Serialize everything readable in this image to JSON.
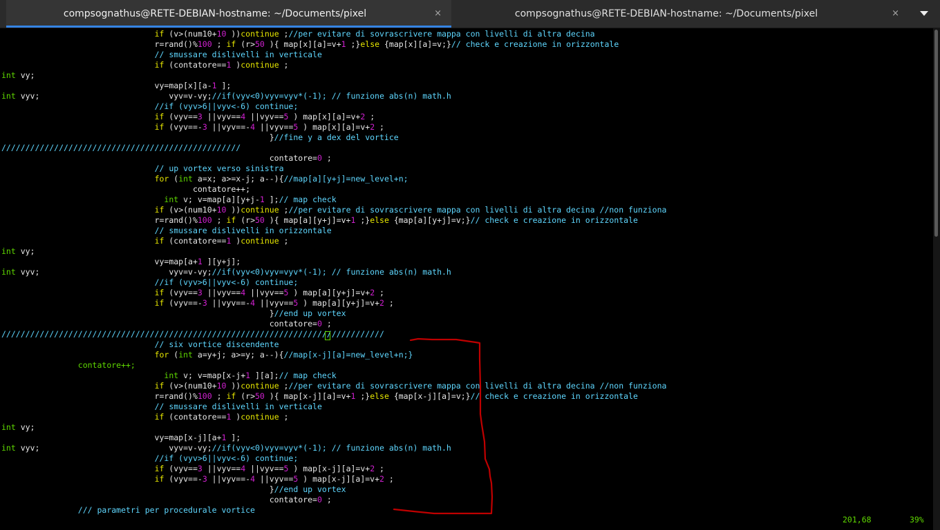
{
  "tabs": [
    {
      "title": "compsognathus@RETE-DEBIAN-hostname: ~/Documents/pixel",
      "active": true
    },
    {
      "title": "compsognathus@RETE-DEBIAN-hostname: ~/Documents/pixel",
      "active": false
    }
  ],
  "close_glyph": "×",
  "status": {
    "position": "201,68",
    "percent": "39%"
  },
  "annotation_color": "#c00000",
  "code_lines": [
    [
      [
        "",
        "                                "
      ],
      [
        "kw",
        "if"
      ],
      [
        "",
        " (v>(num10+"
      ],
      [
        "nm",
        "10"
      ],
      [
        "",
        " ))"
      ],
      [
        "kw",
        "continue"
      ],
      [
        "",
        " ;"
      ],
      [
        "cm",
        "//per evitare di sovrascrivere mappa con livelli di altra decina"
      ]
    ],
    [
      [
        "",
        "                                r=rand()%"
      ],
      [
        "nm",
        "100"
      ],
      [
        "",
        " ; "
      ],
      [
        "kw",
        "if"
      ],
      [
        "",
        " (r>"
      ],
      [
        "nm",
        "50"
      ],
      [
        "",
        " ){ map[x][a]=v+"
      ],
      [
        "nm",
        "1"
      ],
      [
        "",
        " ;}"
      ],
      [
        "kw",
        "else"
      ],
      [
        "",
        " {map[x][a]=v;}"
      ],
      [
        "cm",
        "// check e creazione in orizzontale"
      ]
    ],
    [
      [
        "",
        "                                "
      ],
      [
        "cm",
        "// smussare dislivelli in verticale"
      ]
    ],
    [
      [
        "",
        "                                "
      ],
      [
        "kw",
        "if"
      ],
      [
        "",
        " (contatore=="
      ],
      [
        "nm",
        "1"
      ],
      [
        "",
        " )"
      ],
      [
        "kw",
        "continue"
      ],
      [
        "",
        " ;"
      ]
    ],
    [
      [
        "ty",
        "int"
      ],
      [
        "",
        " vy;"
      ]
    ],
    [
      [
        "",
        "                                vy=map[x][a-"
      ],
      [
        "nm",
        "1"
      ],
      [
        "",
        " ];"
      ]
    ],
    [
      [
        "ty",
        "int"
      ],
      [
        "",
        " vyv;                           vyv=v-vy;"
      ],
      [
        "cm",
        "//if(vyv<0)vyv=vyv*(-1); // funzione abs(n) math.h"
      ]
    ],
    [
      [
        "",
        "                                "
      ],
      [
        "cm",
        "//if (vyv>6||vyv<-6) continue;"
      ]
    ],
    [
      [
        "",
        "                                "
      ],
      [
        "kw",
        "if"
      ],
      [
        "",
        " (vyv=="
      ],
      [
        "nm",
        "3"
      ],
      [
        "",
        " ||vyv=="
      ],
      [
        "nm",
        "4"
      ],
      [
        "",
        " ||vyv=="
      ],
      [
        "nm",
        "5"
      ],
      [
        "",
        " ) map[x][a]=v+"
      ],
      [
        "nm",
        "2"
      ],
      [
        "",
        " ;"
      ]
    ],
    [
      [
        "",
        "                                "
      ],
      [
        "kw",
        "if"
      ],
      [
        "",
        " (vyv==-"
      ],
      [
        "nm",
        "3"
      ],
      [
        "",
        " ||vyv==-"
      ],
      [
        "nm",
        "4"
      ],
      [
        "",
        " ||vyv=="
      ],
      [
        "nm",
        "5"
      ],
      [
        "",
        " ) map[x][a]=v+"
      ],
      [
        "nm",
        "2"
      ],
      [
        "",
        " ;"
      ]
    ],
    [
      [
        "",
        "                                                        }"
      ],
      [
        "cm",
        "//fine y a dex del vortice"
      ]
    ],
    [
      [
        "cm",
        "//////////////////////////////////////////////////"
      ]
    ],
    [
      [
        "",
        "                                                        contatore="
      ],
      [
        "nm",
        "0"
      ],
      [
        "",
        " ;"
      ]
    ],
    [
      [
        "",
        "                                "
      ],
      [
        "cm",
        "// up vortex verso sinistra"
      ]
    ],
    [
      [
        "",
        "                                "
      ],
      [
        "kw",
        "for"
      ],
      [
        "",
        " ("
      ],
      [
        "ty",
        "int"
      ],
      [
        "",
        " a=x; a>=x-j; a--){"
      ],
      [
        "cm",
        "//map[a][y+j]=new_level+n;"
      ]
    ],
    [
      [
        "",
        "                                        contatore++;"
      ]
    ],
    [
      [
        "",
        "                                  "
      ],
      [
        "ty",
        "int"
      ],
      [
        "",
        " v; v=map[a][y+j-"
      ],
      [
        "nm",
        "1"
      ],
      [
        "",
        " ];"
      ],
      [
        "cm",
        "// map check"
      ]
    ],
    [
      [
        "",
        "                                "
      ],
      [
        "kw",
        "if"
      ],
      [
        "",
        " (v>(num10+"
      ],
      [
        "nm",
        "10"
      ],
      [
        "",
        " ))"
      ],
      [
        "kw",
        "continue"
      ],
      [
        "",
        " ;"
      ],
      [
        "cm",
        "//per evitare di sovrascrivere mappa con livelli di altra decina //non funziona"
      ]
    ],
    [
      [
        "",
        "                                r=rand()%"
      ],
      [
        "nm",
        "100"
      ],
      [
        "",
        " ; "
      ],
      [
        "kw",
        "if"
      ],
      [
        "",
        " (r>"
      ],
      [
        "nm",
        "50"
      ],
      [
        "",
        " ){ map[a][y+j]=v+"
      ],
      [
        "nm",
        "1"
      ],
      [
        "",
        " ;}"
      ],
      [
        "kw",
        "else"
      ],
      [
        "",
        " {map[a][y+j]=v;}"
      ],
      [
        "cm",
        "// check e creazione in orizzontale"
      ]
    ],
    [
      [
        "",
        "                                "
      ],
      [
        "cm",
        "// smussare dislivelli in orizzontale"
      ]
    ],
    [
      [
        "",
        "                                "
      ],
      [
        "kw",
        "if"
      ],
      [
        "",
        " (contatore=="
      ],
      [
        "nm",
        "1"
      ],
      [
        "",
        " )"
      ],
      [
        "kw",
        "continue"
      ],
      [
        "",
        " ;"
      ]
    ],
    [
      [
        "ty",
        "int"
      ],
      [
        "",
        " vy;"
      ]
    ],
    [
      [
        "",
        "                                vy=map[a+"
      ],
      [
        "nm",
        "1"
      ],
      [
        "",
        " ][y+j];"
      ]
    ],
    [
      [
        "ty",
        "int"
      ],
      [
        "",
        " vyv;                           vyv=v-vy;"
      ],
      [
        "cm",
        "//if(vyv<0)vyv=vyv*(-1); // funzione abs(n) math.h"
      ]
    ],
    [
      [
        "",
        "                                "
      ],
      [
        "cm",
        "//if (vyv>6||vyv<-6) continue;"
      ]
    ],
    [
      [
        "",
        "                                "
      ],
      [
        "kw",
        "if"
      ],
      [
        "",
        " (vyv=="
      ],
      [
        "nm",
        "3"
      ],
      [
        "",
        " ||vyv=="
      ],
      [
        "nm",
        "4"
      ],
      [
        "",
        " ||vyv=="
      ],
      [
        "nm",
        "5"
      ],
      [
        "",
        " ) map[a][y+j]=v+"
      ],
      [
        "nm",
        "2"
      ],
      [
        "",
        " ;"
      ]
    ],
    [
      [
        "",
        "                                "
      ],
      [
        "kw",
        "if"
      ],
      [
        "",
        " (vyv==-"
      ],
      [
        "nm",
        "3"
      ],
      [
        "",
        " ||vyv==-"
      ],
      [
        "nm",
        "4"
      ],
      [
        "",
        " ||vyv=="
      ],
      [
        "nm",
        "5"
      ],
      [
        "",
        " ) map[a][y+j]=v+"
      ],
      [
        "nm",
        "2"
      ],
      [
        "",
        " ;"
      ]
    ],
    [
      [
        "",
        "                                                        }"
      ],
      [
        "cm",
        "//end up vortex"
      ]
    ],
    [
      [
        "",
        "                                                        contatore="
      ],
      [
        "nm",
        "0"
      ],
      [
        "",
        " ;"
      ]
    ],
    [
      [
        "cm",
        "////////////////////////////////////////////////////////////////////////////////"
      ]
    ],
    [
      [
        "",
        "                                "
      ],
      [
        "cm",
        "// six vortice discendente"
      ]
    ],
    [
      [
        "",
        "                                "
      ],
      [
        "kw",
        "for"
      ],
      [
        "",
        " ("
      ],
      [
        "ty",
        "int"
      ],
      [
        "",
        " a=y+j; a>=y; a--){"
      ],
      [
        "cm",
        "//map[x-j][a]=new_level+n;}"
      ]
    ],
    [
      [
        "ty",
        "                contatore++;"
      ]
    ],
    [
      [
        "",
        "                                  "
      ],
      [
        "ty",
        "int"
      ],
      [
        "",
        " v; v=map[x-j+"
      ],
      [
        "nm",
        "1"
      ],
      [
        "",
        " ][a];"
      ],
      [
        "cm",
        "// map check"
      ]
    ],
    [
      [
        "",
        "                                "
      ],
      [
        "kw",
        "if"
      ],
      [
        "",
        " (v>(num10+"
      ],
      [
        "nm",
        "10"
      ],
      [
        "",
        " ))"
      ],
      [
        "kw",
        "continue"
      ],
      [
        "",
        " ;"
      ],
      [
        "cm",
        "//per evitare di sovrascrivere mappa con livelli di altra decina //non funziona"
      ]
    ],
    [
      [
        "",
        "                                r=rand()%"
      ],
      [
        "nm",
        "100"
      ],
      [
        "",
        " ; "
      ],
      [
        "kw",
        "if"
      ],
      [
        "",
        " (r>"
      ],
      [
        "nm",
        "50"
      ],
      [
        "",
        " ){ map[x-j][a]=v+"
      ],
      [
        "nm",
        "1"
      ],
      [
        "",
        " ;}"
      ],
      [
        "kw",
        "else"
      ],
      [
        "",
        " {map[x-j][a]=v;}"
      ],
      [
        "cm",
        "// check e creazione in orizzontale"
      ]
    ],
    [
      [
        "",
        "                                "
      ],
      [
        "cm",
        "// smussare dislivelli in verticale"
      ]
    ],
    [
      [
        "",
        "                                "
      ],
      [
        "kw",
        "if"
      ],
      [
        "",
        " (contatore=="
      ],
      [
        "nm",
        "1"
      ],
      [
        "",
        " )"
      ],
      [
        "kw",
        "continue"
      ],
      [
        "",
        " ;"
      ]
    ],
    [
      [
        "ty",
        "int"
      ],
      [
        "",
        " vy;"
      ]
    ],
    [
      [
        "",
        "                                vy=map[x-j][a+"
      ],
      [
        "nm",
        "1"
      ],
      [
        "",
        " ];"
      ]
    ],
    [
      [
        "ty",
        "int"
      ],
      [
        "",
        " vyv;                           vyv=v-vy;"
      ],
      [
        "cm",
        "//if(vyv<0)vyv=vyv*(-1); // funzione abs(n) math.h"
      ]
    ],
    [
      [
        "",
        "                                "
      ],
      [
        "cm",
        "//if (vyv>6||vyv<-6) continue;"
      ]
    ],
    [
      [
        "",
        "                                "
      ],
      [
        "kw",
        "if"
      ],
      [
        "",
        " (vyv=="
      ],
      [
        "nm",
        "3"
      ],
      [
        "",
        " ||vyv=="
      ],
      [
        "nm",
        "4"
      ],
      [
        "",
        " ||vyv=="
      ],
      [
        "nm",
        "5"
      ],
      [
        "",
        " ) map[x-j][a]=v+"
      ],
      [
        "nm",
        "2"
      ],
      [
        "",
        " ;"
      ]
    ],
    [
      [
        "",
        "                                "
      ],
      [
        "kw",
        "if"
      ],
      [
        "",
        " (vyv==-"
      ],
      [
        "nm",
        "3"
      ],
      [
        "",
        " ||vyv==-"
      ],
      [
        "nm",
        "4"
      ],
      [
        "",
        " ||vyv=="
      ],
      [
        "nm",
        "5"
      ],
      [
        "",
        " ) map[x-j][a]=v+"
      ],
      [
        "nm",
        "2"
      ],
      [
        "",
        " ;"
      ]
    ],
    [
      [
        "",
        "                                                        }"
      ],
      [
        "cm",
        "//end up vortex"
      ]
    ],
    [
      [
        "",
        "                                                        contatore="
      ],
      [
        "nm",
        "0"
      ],
      [
        "",
        " ;"
      ]
    ],
    [
      [
        "",
        "                "
      ],
      [
        "cm",
        "/// parametri per procedurale vortice"
      ]
    ]
  ]
}
